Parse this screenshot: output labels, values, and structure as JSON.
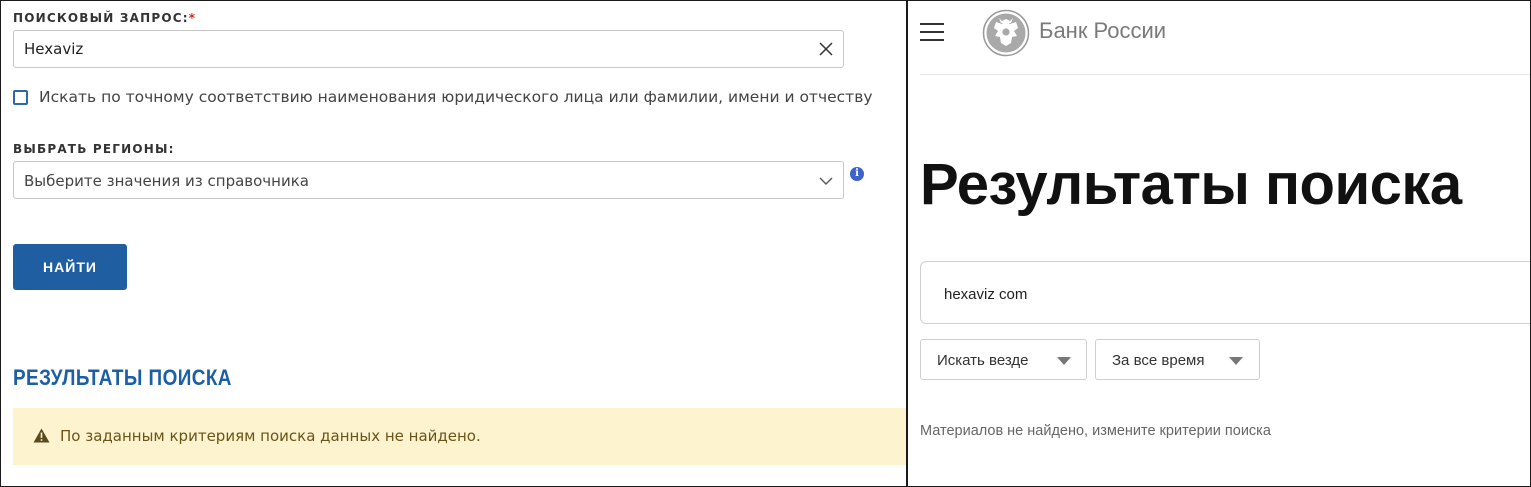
{
  "left_panel": {
    "query_label": "ПОИСКОВЫЙ ЗАПРОС:",
    "required_mark": "*",
    "query_value": "Hexaviz",
    "exact_match_label": "Искать по точному соответствию наименования юридического лица или фамилии, имени и отчеству",
    "exact_match_checked": false,
    "regions_label": "ВЫБРАТЬ РЕГИОНЫ:",
    "regions_placeholder": "Выберите значения из справочника",
    "info_glyph": "i",
    "find_button": "НАЙТИ",
    "results_title": "РЕЗУЛЬТАТЫ ПОИСКА",
    "alert_text": "По заданным критериям поиска данных не найдено.",
    "colors": {
      "accent": "#1f5fa1",
      "title": "#1c5fa4",
      "alert_bg": "#fdf3cf",
      "required": "#d9261c"
    },
    "icons": [
      "clear-icon",
      "chevron-down-icon",
      "info-icon",
      "warning-icon"
    ]
  },
  "right_panel": {
    "brand_name": "Банк России",
    "page_title": "Результаты поиска",
    "search_value": "hexaviz com",
    "scope_filter": "Искать везде",
    "period_filter": "За все время",
    "no_results_text": "Материалов не найдено, измените критерии поиска",
    "icons": [
      "menu-icon",
      "emblem-icon",
      "triangle-down-icon"
    ]
  }
}
